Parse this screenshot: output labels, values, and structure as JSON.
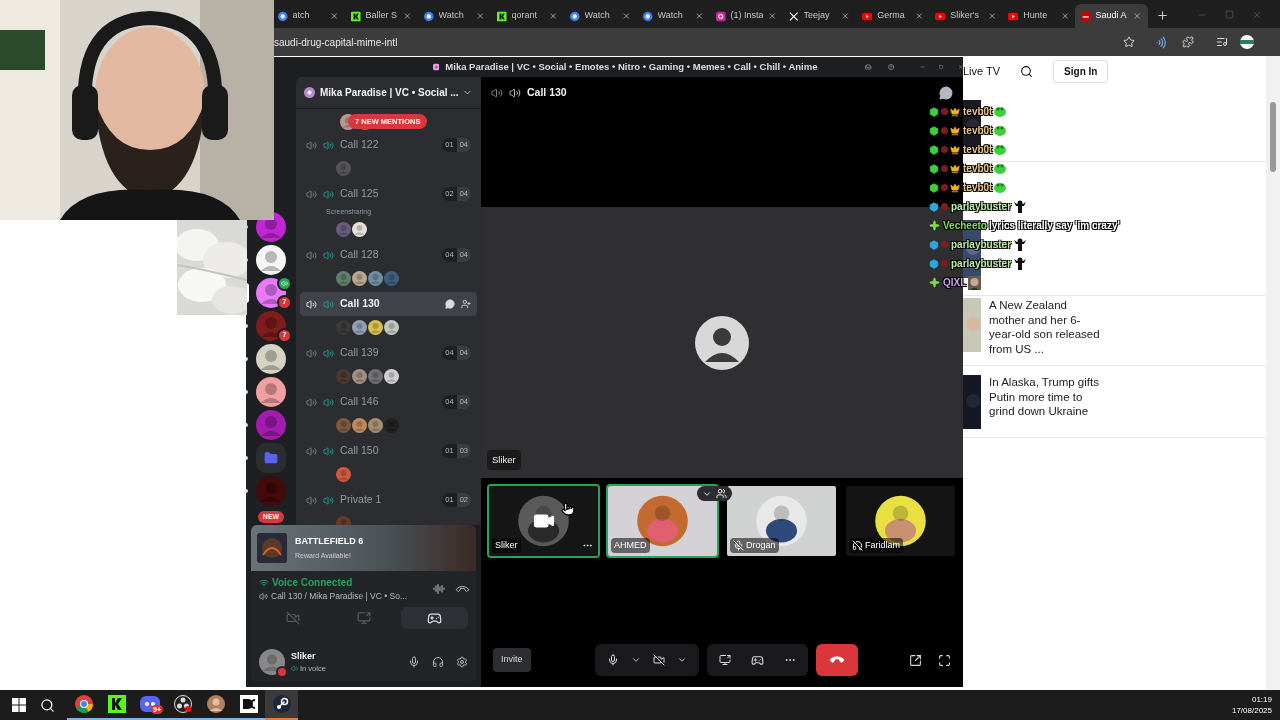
{
  "browser": {
    "tabs": [
      {
        "title": "atch",
        "kind": "watch",
        "selected": false
      },
      {
        "title": "Baller S",
        "kind": "kick",
        "selected": false
      },
      {
        "title": "Watch",
        "kind": "watch",
        "selected": false
      },
      {
        "title": "qorant",
        "kind": "kick",
        "selected": false
      },
      {
        "title": "Watch",
        "kind": "watch",
        "selected": false
      },
      {
        "title": "Watch",
        "kind": "watch",
        "selected": false
      },
      {
        "title": "(1) Insta",
        "kind": "instagram",
        "selected": false
      },
      {
        "title": "Teejay",
        "kind": "x",
        "selected": false
      },
      {
        "title": "Germa",
        "kind": "youtube",
        "selected": false
      },
      {
        "title": "Sliker's",
        "kind": "youtube",
        "selected": false
      },
      {
        "title": "Hunte",
        "kind": "youtube",
        "selected": false
      },
      {
        "title": "Saudi A",
        "kind": "cnn",
        "selected": true
      }
    ],
    "url": "saudi-drug-capital-mime-intl"
  },
  "site": {
    "live": "Live TV",
    "sign_in": "Sign In",
    "news": [
      {
        "text": "A New Zealand mother and her 6-year-old son released from US ..."
      },
      {
        "text": "In Alaska, Trump gifts Putin more time to grind down Ukraine"
      }
    ]
  },
  "discord": {
    "title": "Mika Paradise | VC • Social • Emotes • Nitro • Gaming • Memes • Call • Chill • Anime",
    "servers": [
      {
        "color": "#c026d3",
        "selected": false
      },
      {
        "color": "#f5f5f5",
        "selected": false
      },
      {
        "color": "#e879f9",
        "selected": true,
        "badge": "7",
        "in_voice": true
      },
      {
        "color": "#7f1d1d",
        "selected": false,
        "badge": "7",
        "in_voice": false
      },
      {
        "color": "#d6d3c4",
        "selected": false
      },
      {
        "color": "#f0a0a0",
        "selected": false
      },
      {
        "color": "#a21caf",
        "selected": false
      },
      {
        "color": "#5865f2",
        "selected": false,
        "kind": "folder"
      },
      {
        "color": "#450a0a",
        "selected": false
      }
    ],
    "new_label": "NEW",
    "server_name": "Mika Paradise | VC • Social ...",
    "mentions": "7 NEW MENTIONS",
    "channels": [
      {
        "name": "Call 122",
        "users": "01",
        "limit": "04",
        "selected": false,
        "avatars": [
          {
            "color": "#555555"
          }
        ]
      },
      {
        "name": "Call 125",
        "users": "02",
        "limit": "04",
        "selected": false,
        "note": "Screensharing",
        "avatars": [
          {
            "color": "#6b5b7b"
          },
          {
            "color": "#e5e1da"
          }
        ]
      },
      {
        "name": "Call 128",
        "users": "04",
        "limit": "04",
        "selected": false,
        "avatars": [
          {
            "color": "#5f7f6f"
          },
          {
            "color": "#b8a890"
          },
          {
            "color": "#6f8fa0"
          },
          {
            "color": "#3f5f7f"
          }
        ]
      },
      {
        "name": "Call 130",
        "selected": true,
        "avatars": [
          {
            "color": "#3a3a3a"
          },
          {
            "color": "#8fa0b0"
          },
          {
            "color": "#d4c04a"
          },
          {
            "color": "#c0c8c0"
          }
        ]
      },
      {
        "name": "Call 139",
        "users": "04",
        "limit": "04",
        "selected": false,
        "avatars": [
          {
            "color": "#4a3a30"
          },
          {
            "color": "#a09080"
          },
          {
            "color": "#707070"
          },
          {
            "color": "#d0d0d0"
          }
        ]
      },
      {
        "name": "Call 146",
        "users": "04",
        "limit": "04",
        "selected": false,
        "avatars": [
          {
            "color": "#7a5a40"
          },
          {
            "color": "#c08a60"
          },
          {
            "color": "#a09070"
          },
          {
            "color": "#202020"
          }
        ]
      },
      {
        "name": "Call 150",
        "users": "01",
        "limit": "03",
        "selected": false,
        "avatars": [
          {
            "color": "#d05a40"
          }
        ]
      },
      {
        "name": "Private 1",
        "users": "01",
        "limit": "02",
        "selected": false,
        "avatars": [
          {
            "color": "#6a3a2a"
          }
        ]
      }
    ],
    "game": {
      "title": "BATTLEFIELD 6",
      "subtitle": "Reward Available!"
    },
    "voice": {
      "status": "Voice Connected",
      "channel": "Call 130 / Mika Paradise | VC • So..."
    },
    "panel_buttons": [
      {
        "kind": "camera",
        "selected": false
      },
      {
        "kind": "screen",
        "selected": false
      },
      {
        "kind": "activity",
        "selected": true
      }
    ],
    "user": {
      "name": "Sliker",
      "status": "In voice"
    },
    "call": {
      "title": "Call 130",
      "focused": "Sliker",
      "invite": "Invite",
      "tiles": [
        {
          "name": "Sliker",
          "speaking": true,
          "kind": "hover"
        },
        {
          "name": "AHMED",
          "speaking": true,
          "kind": "plain"
        },
        {
          "name": "Drogan",
          "speaking": false,
          "kind": "mic-muted"
        },
        {
          "name": "Faridlam",
          "speaking": false,
          "kind": "deafened"
        }
      ]
    }
  },
  "chat": [
    {
      "user": "tevb0t",
      "color": "#e8c48a",
      "badges": [
        {
          "kind": "cube",
          "color": "#3ecf3e"
        },
        {
          "kind": "dot",
          "color": "#7f1d1d"
        },
        {
          "kind": "crown",
          "color": "#f0b020"
        }
      ],
      "emote": {
        "kind": "frog"
      }
    },
    {
      "user": "tevb0t",
      "color": "#e8c48a",
      "badges": [
        {
          "kind": "cube",
          "color": "#3ecf3e"
        },
        {
          "kind": "dot",
          "color": "#7f1d1d"
        },
        {
          "kind": "crown",
          "color": "#f0b020"
        }
      ],
      "emote": {
        "kind": "frog"
      }
    },
    {
      "user": "tevb0t",
      "color": "#e8c48a",
      "badges": [
        {
          "kind": "cube",
          "color": "#3ecf3e"
        },
        {
          "kind": "dot",
          "color": "#7f1d1d"
        },
        {
          "kind": "crown",
          "color": "#f0b020"
        }
      ],
      "emote": {
        "kind": "frog"
      }
    },
    {
      "user": "tevb0t",
      "color": "#e8c48a",
      "badges": [
        {
          "kind": "cube",
          "color": "#3ecf3e"
        },
        {
          "kind": "dot",
          "color": "#7f1d1d"
        },
        {
          "kind": "crown",
          "color": "#f0b020"
        }
      ],
      "emote": {
        "kind": "frog"
      }
    },
    {
      "user": "tevb0t",
      "color": "#e8c48a",
      "badges": [
        {
          "kind": "cube",
          "color": "#3ecf3e"
        },
        {
          "kind": "dot",
          "color": "#7f1d1d"
        },
        {
          "kind": "crown",
          "color": "#f0b020"
        }
      ],
      "emote": {
        "kind": "frog"
      }
    },
    {
      "user": "parlaybuster",
      "color": "#b8f0a0",
      "badges": [
        {
          "kind": "cube",
          "color": "#2fa8e0"
        },
        {
          "kind": "dot",
          "color": "#7f1d1d"
        }
      ],
      "emote": {
        "kind": "figure"
      }
    },
    {
      "user": "Vecheeto",
      "color": "#7fe050",
      "badges": [
        {
          "kind": "star",
          "color": "#7fe050"
        }
      ],
      "text": "lyrics literally say 'im crazy'"
    },
    {
      "user": "parlaybuster",
      "color": "#b8f0a0",
      "badges": [
        {
          "kind": "cube",
          "color": "#2fa8e0"
        },
        {
          "kind": "dot",
          "color": "#7f1d1d"
        }
      ],
      "emote": {
        "kind": "figure"
      }
    },
    {
      "user": "parlaybuster",
      "color": "#b8f0a0",
      "badges": [
        {
          "kind": "cube",
          "color": "#2fa8e0"
        },
        {
          "kind": "dot",
          "color": "#7f1d1d"
        }
      ],
      "emote": {
        "kind": "figure"
      }
    },
    {
      "user": "QIXL",
      "color": "#c9a0f0",
      "badges": [
        {
          "kind": "star",
          "color": "#7fe050"
        }
      ],
      "emote": {
        "kind": "face"
      }
    }
  ],
  "taskbar": {
    "apps": [
      {
        "kind": "chrome"
      },
      {
        "kind": "kick"
      },
      {
        "kind": "discord",
        "badge": "9+"
      },
      {
        "kind": "obs"
      },
      {
        "kind": "avatar"
      },
      {
        "kind": "dc"
      },
      {
        "kind": "steam"
      }
    ],
    "time": "01:19",
    "date": "17/08/2025"
  }
}
